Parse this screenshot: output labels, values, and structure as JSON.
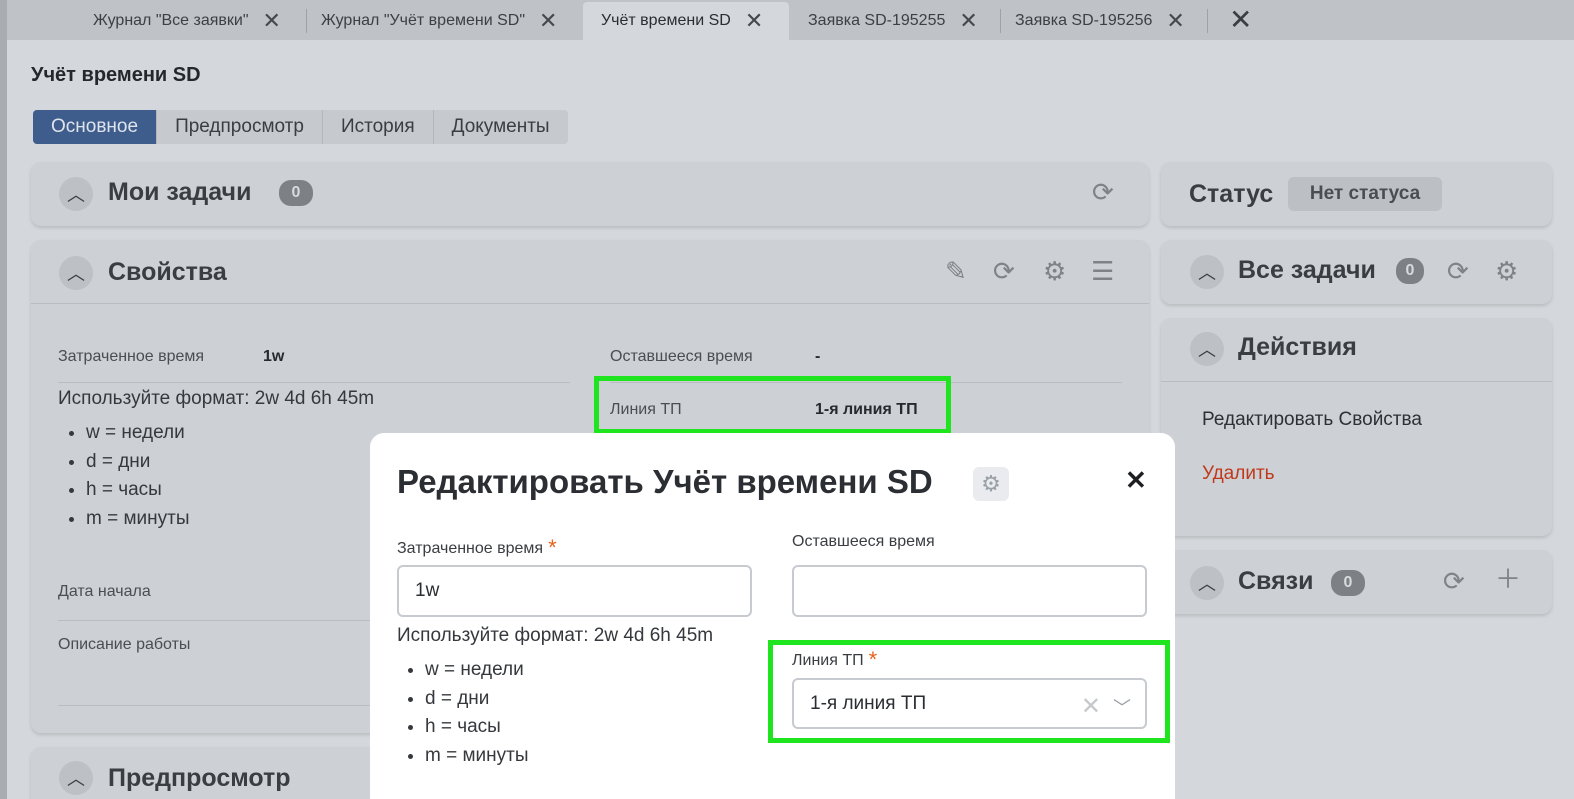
{
  "tabs": [
    {
      "label": "Журнал \"Все заявки\""
    },
    {
      "label": "Журнал \"Учёт времени SD\""
    },
    {
      "label": "Учёт времени SD"
    },
    {
      "label": "Заявка SD-195255"
    },
    {
      "label": "Заявка SD-195256"
    }
  ],
  "page": {
    "title": "Учёт времени SD"
  },
  "subtabs": [
    "Основное",
    "Предпросмотр",
    "История",
    "Документы"
  ],
  "my_tasks": {
    "title": "Мои задачи",
    "count": "0"
  },
  "properties": {
    "title": "Свойства",
    "spent_label": "Затраченное время",
    "spent_value": "1w",
    "remaining_label": "Оставшееся время",
    "remaining_value": "-",
    "line_label": "Линия ТП",
    "line_value": "1-я линия ТП",
    "format_hint": "Используйте формат: 2w 4d 6h 45m",
    "format_items": [
      "w = недели",
      "d = дни",
      "h = часы",
      "m = минуты"
    ],
    "start_date_label": "Дата начала",
    "description_label": "Описание работы"
  },
  "preview_panel": {
    "title": "Предпросмотр"
  },
  "status": {
    "label": "Статус",
    "value": "Нет статуса"
  },
  "all_tasks": {
    "title": "Все задачи",
    "count": "0"
  },
  "actions": {
    "title": "Действия",
    "edit": "Редактировать Свойства",
    "delete": "Удалить"
  },
  "links": {
    "title": "Связи",
    "count": "0"
  },
  "modal": {
    "title": "Редактировать Учёт времени SD",
    "spent_label": "Затраченное время",
    "spent_value": "1w",
    "remaining_label": "Оставшееся время",
    "remaining_value": "",
    "format_hint": "Используйте формат: 2w 4d 6h 45m",
    "format_items": [
      "w = недели",
      "d = дни",
      "h = часы",
      "m = минуты"
    ],
    "line_label": "Линия ТП",
    "line_value": "1-я линия ТП",
    "required_mark": "*"
  },
  "colors": {
    "highlight": "#1ee51e",
    "primary_tab": "#3e5d8c",
    "required": "#e5631e",
    "delete": "#c0391b"
  }
}
